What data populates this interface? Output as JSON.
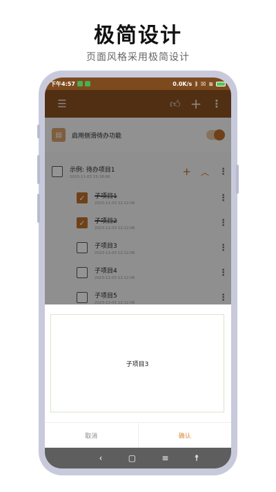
{
  "promo": {
    "headline": "极简设计",
    "subline": "页面风格采用极简设计"
  },
  "statusbar": {
    "time": "下午4:57",
    "speed": "0.0K/s",
    "battery": "88"
  },
  "toolbar": {
    "menu_icon": "list-icon",
    "like_icon": "thumbs-up-icon",
    "add_icon": "plus-icon",
    "more_icon": "more-vertical-icon"
  },
  "settings": {
    "swipe_label": "启用侧滑待办功能",
    "swipe_enabled": true
  },
  "todo": {
    "parent": {
      "title": "示例: 待办项目1",
      "time": "2023-11-03 15:18:06"
    },
    "children": [
      {
        "title": "子项目1",
        "time": "2023-11-03 12:12:06",
        "checked": true
      },
      {
        "title": "子项目2",
        "time": "2023-11-03 12:12:06",
        "checked": true
      },
      {
        "title": "子项目3",
        "time": "2023-11-03 12:12:06",
        "checked": false
      },
      {
        "title": "子项目4",
        "time": "2023-11-03 12:12:06",
        "checked": false
      },
      {
        "title": "子项目5",
        "time": "2023-11-03 12:12:06",
        "checked": false
      }
    ]
  },
  "dialog": {
    "text": "子项目3",
    "cancel_label": "取消",
    "confirm_label": "确认"
  },
  "colors": {
    "appbar": "#8a5121",
    "accent": "#c0712c",
    "confirm": "#d98b3c"
  }
}
